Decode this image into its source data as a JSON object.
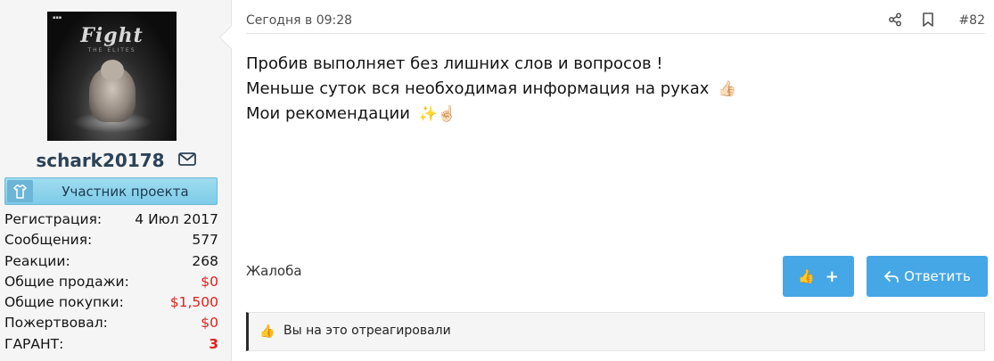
{
  "user": {
    "avatar_title": "Fight",
    "avatar_subtitle": "THE ELITES",
    "username": "schark20178",
    "role_badge": "Участник проекта",
    "stats": [
      {
        "label": "Регистрация:",
        "value": "4 Июл 2017",
        "style": "normal"
      },
      {
        "label": "Сообщения:",
        "value": "577",
        "style": "normal"
      },
      {
        "label": "Реакции:",
        "value": "268",
        "style": "normal"
      },
      {
        "label": "Общие продажи:",
        "value": "$0",
        "style": "red"
      },
      {
        "label": "Общие покупки:",
        "value": "$1,500",
        "style": "red"
      },
      {
        "label": "Пожертвовал:",
        "value": "$0",
        "style": "red"
      },
      {
        "label": "ГАРАНТ:",
        "value": "3",
        "style": "red-bold"
      }
    ]
  },
  "post": {
    "date": "Сегодня в 09:28",
    "number": "#82",
    "lines": [
      {
        "text": "Пробив выполняет без лишних слов и вопросов !",
        "emoji": ""
      },
      {
        "text": "Меньше суток вся необходимая информация на руках",
        "emoji": "👍🏻"
      },
      {
        "text": "Мои рекомендации",
        "emoji": "✨☝🏻"
      }
    ],
    "complain_label": "Жалоба",
    "react_button": {
      "emoji": "👍",
      "plus": "+"
    },
    "reply_label": "Ответить",
    "reaction_emoji": "👍",
    "reaction_text": "Вы на это отреагировали"
  },
  "icons": [
    "mail-icon",
    "shirt-icon",
    "share-icon",
    "bookmark-icon",
    "reply-icon",
    "thumbs-up-icon"
  ],
  "colors": {
    "accent_button": "#46a7e6",
    "username": "#2b4257",
    "badge": "#8fd3ee",
    "negative_value": "#e0201b"
  }
}
